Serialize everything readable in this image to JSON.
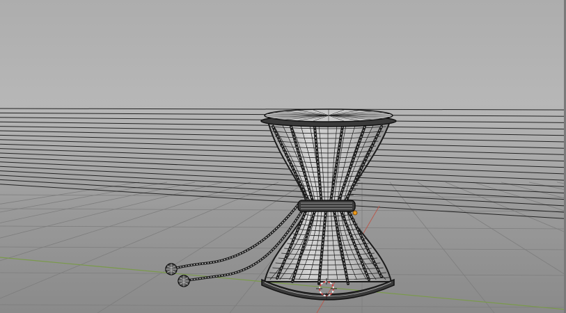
{
  "viewport": {
    "mode": "3d-viewport-wireframe",
    "object": "damaru-drum",
    "colors": {
      "background_top": "#adadad",
      "background_bottom": "#8a8a8a",
      "grid_line": "#7d7d7d",
      "axis_x": "#b85a4e",
      "axis_y": "#7a9a4a",
      "wire": "#1a1a1a",
      "mesh_fill": "#c7c7c7",
      "origin": "#e89a1c",
      "cursor_ring": "#d44040"
    },
    "icons": {
      "cursor": "3d-cursor-icon",
      "origin": "origin-point-icon"
    }
  }
}
